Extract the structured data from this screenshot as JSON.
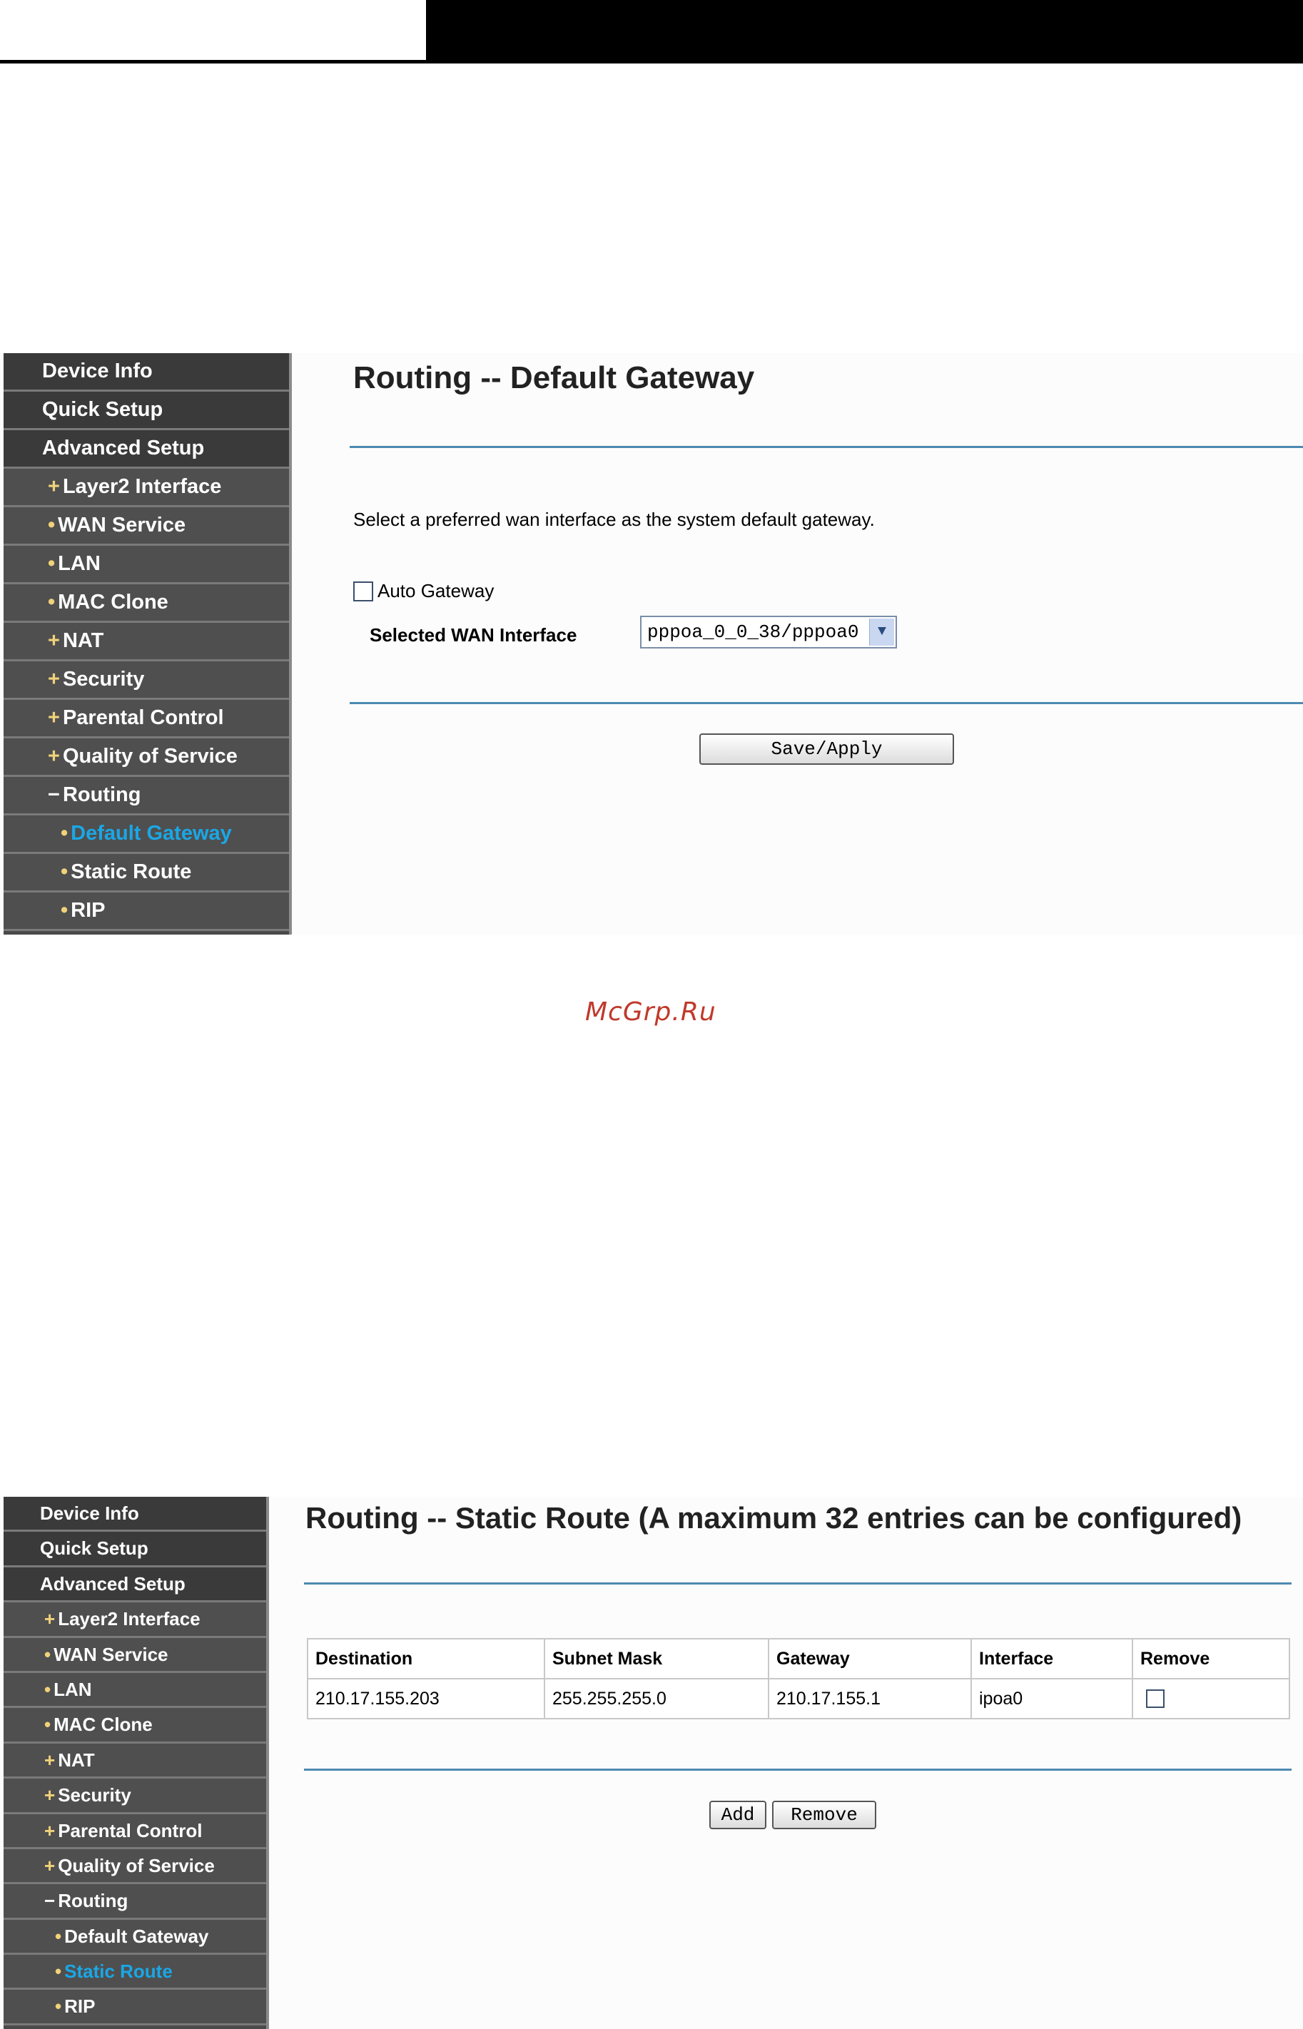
{
  "watermark": "McGrp.Ru",
  "screen1": {
    "menu": [
      {
        "label": "Device Info",
        "marker": ""
      },
      {
        "label": "Quick Setup",
        "marker": ""
      },
      {
        "label": "Advanced Setup",
        "marker": ""
      },
      {
        "label": "Layer2 Interface",
        "marker": "+"
      },
      {
        "label": "WAN Service",
        "marker": "•"
      },
      {
        "label": "LAN",
        "marker": "•"
      },
      {
        "label": "MAC Clone",
        "marker": "•"
      },
      {
        "label": "NAT",
        "marker": "+"
      },
      {
        "label": "Security",
        "marker": "+"
      },
      {
        "label": "Parental Control",
        "marker": "+"
      },
      {
        "label": "Quality of Service",
        "marker": "+"
      },
      {
        "label": "Routing",
        "marker": "−"
      },
      {
        "label": "Default Gateway",
        "marker": "•"
      },
      {
        "label": "Static Route",
        "marker": "•"
      },
      {
        "label": "RIP",
        "marker": "•"
      }
    ],
    "title": "Routing -- Default Gateway",
    "description": "Select a preferred wan interface as the system default gateway.",
    "auto_gateway_label": "Auto Gateway",
    "auto_gateway_checked": false,
    "wan_label": "Selected WAN Interface",
    "wan_value": "pppoa_0_0_38/pppoa0",
    "save_label": "Save/Apply"
  },
  "screen2": {
    "menu": [
      {
        "label": "Device Info",
        "marker": ""
      },
      {
        "label": "Quick Setup",
        "marker": ""
      },
      {
        "label": "Advanced Setup",
        "marker": ""
      },
      {
        "label": "Layer2 Interface",
        "marker": "+"
      },
      {
        "label": "WAN Service",
        "marker": "•"
      },
      {
        "label": "LAN",
        "marker": "•"
      },
      {
        "label": "MAC Clone",
        "marker": "•"
      },
      {
        "label": "NAT",
        "marker": "+"
      },
      {
        "label": "Security",
        "marker": "+"
      },
      {
        "label": "Parental Control",
        "marker": "+"
      },
      {
        "label": "Quality of Service",
        "marker": "+"
      },
      {
        "label": "Routing",
        "marker": "−"
      },
      {
        "label": "Default Gateway",
        "marker": "•"
      },
      {
        "label": "Static Route",
        "marker": "•"
      },
      {
        "label": "RIP",
        "marker": "•"
      }
    ],
    "title": "Routing -- Static Route (A maximum 32 entries can be configured)",
    "table": {
      "headers": [
        "Destination",
        "Subnet Mask",
        "Gateway",
        "Interface",
        "Remove"
      ],
      "rows": [
        {
          "destination": "210.17.155.203",
          "subnet_mask": "255.255.255.0",
          "gateway": "210.17.155.1",
          "interface": "ipoa0",
          "remove_checked": false
        }
      ]
    },
    "add_label": "Add",
    "remove_label": "Remove"
  }
}
